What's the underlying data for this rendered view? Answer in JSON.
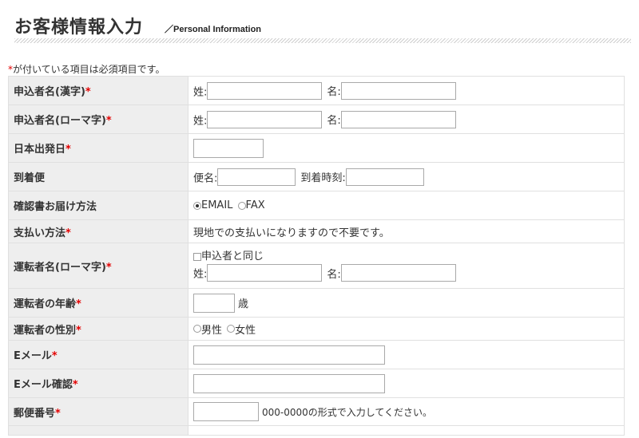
{
  "header": {
    "title": "お客様情報入力",
    "subtitle": "／Personal Information"
  },
  "required_note": {
    "mark": "*",
    "text": "が付いている項目は必須項目です。"
  },
  "required_mark": "*",
  "rows": {
    "applicant_kanji": {
      "label": "申込者名(漢字)",
      "last_label": "姓:",
      "first_label": "名:"
    },
    "applicant_roman": {
      "label": "申込者名(ローマ字)",
      "last_label": "姓:",
      "first_label": "名:"
    },
    "departure_date": {
      "label": "日本出発日"
    },
    "arrival_flight": {
      "label": "到着便",
      "flight_label": "便名:",
      "time_label": "到着時刻:"
    },
    "confirmation_delivery": {
      "label": "確認書お届け方法",
      "options": [
        "EMAIL",
        "FAX"
      ],
      "selected": "EMAIL"
    },
    "payment": {
      "label": "支払い方法",
      "text": "現地での支払いになりますので不要です。"
    },
    "driver_roman": {
      "label": "運転者名(ローマ字)",
      "same_as_label": "申込者と同じ",
      "last_label": "姓:",
      "first_label": "名:"
    },
    "driver_age": {
      "label": "運転者の年齢",
      "unit": "歳"
    },
    "driver_gender": {
      "label": "運転者の性別",
      "options": [
        "男性",
        "女性"
      ]
    },
    "email": {
      "label": "Eメール"
    },
    "email_confirm": {
      "label": "Eメール確認"
    },
    "postal_code": {
      "label": "郵便番号",
      "hint": "000-0000の形式で入力してください。"
    }
  }
}
